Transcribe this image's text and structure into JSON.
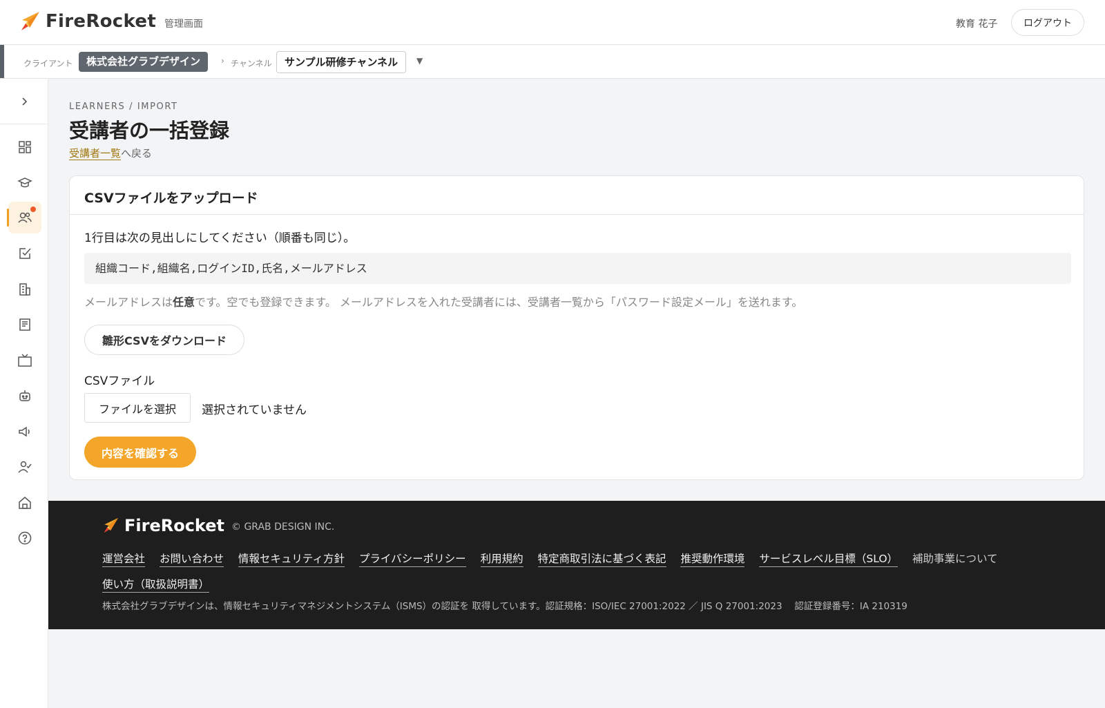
{
  "header": {
    "brand": "FireRocket",
    "admin_label": "管理画面",
    "user_name": "教育 花子",
    "logout_label": "ログアウト"
  },
  "context": {
    "client_label": "クライアント",
    "client_value": "株式会社グラブデザイン",
    "separator": "›",
    "channel_label": "チャンネル",
    "channel_value": "サンプル研修チャンネル",
    "caret": "▼"
  },
  "sidebar": {
    "toggle_icon": "chevron-right-icon",
    "items": [
      {
        "icon": "dashboard-icon",
        "active": false
      },
      {
        "icon": "graduation-cap-icon",
        "active": false
      },
      {
        "icon": "users-icon",
        "active": true,
        "badge": true
      },
      {
        "icon": "checkbox-icon",
        "active": false
      },
      {
        "icon": "building-icon",
        "active": false
      },
      {
        "icon": "book-icon",
        "active": false
      },
      {
        "icon": "tv-icon",
        "active": false
      },
      {
        "icon": "robot-icon",
        "active": false
      },
      {
        "icon": "megaphone-icon",
        "active": false
      },
      {
        "icon": "user-check-icon",
        "active": false
      },
      {
        "icon": "home-icon",
        "active": false
      },
      {
        "icon": "help-icon",
        "active": false
      }
    ]
  },
  "main": {
    "breadcrumb": "LEARNERS / IMPORT",
    "title": "受講者の一括登録",
    "back_link": "受講者一覧",
    "back_suffix": "へ戻る",
    "card": {
      "title": "CSVファイルをアップロード",
      "instruction": "1行目は次の見出しにしてください（順番も同じ）。",
      "header_example": "組織コード,組織名,ログインID,氏名,メールアドレス",
      "note_prefix": "メールアドレスは",
      "note_bold": "任意",
      "note_suffix": "です。空でも登録できます。 メールアドレスを入れた受講者には、受講者一覧から「パスワード設定メール」を送れます。",
      "template_button": "雛形CSVをダウンロード",
      "file_label": "CSVファイル",
      "file_button": "ファイルを選択",
      "file_status": "選択されていません",
      "confirm_button": "内容を確認する"
    }
  },
  "footer": {
    "brand": "FireRocket",
    "copyright": "© GRAB DESIGN INC.",
    "links": [
      "運営会社",
      "お問い合わせ",
      "情報セキュリティ方針",
      "プライバシーポリシー",
      "利用規約",
      "特定商取引法に基づく表記",
      "推奨動作環境",
      "サービスレベル目標（SLO）",
      "補助事業について",
      "使い方（取扱説明書）"
    ],
    "isms": "株式会社グラブデザインは、情報セキュリティマネジメントシステム（ISMS）の認証を 取得しています。認証規格：ISO/IEC 27001:2022 ／ JIS Q 27001:2023　 認証登録番号：IA 210319"
  },
  "colors": {
    "accent": "#f4a62a",
    "client_pill": "#5f666d",
    "footer_bg": "#1e1e1e"
  }
}
